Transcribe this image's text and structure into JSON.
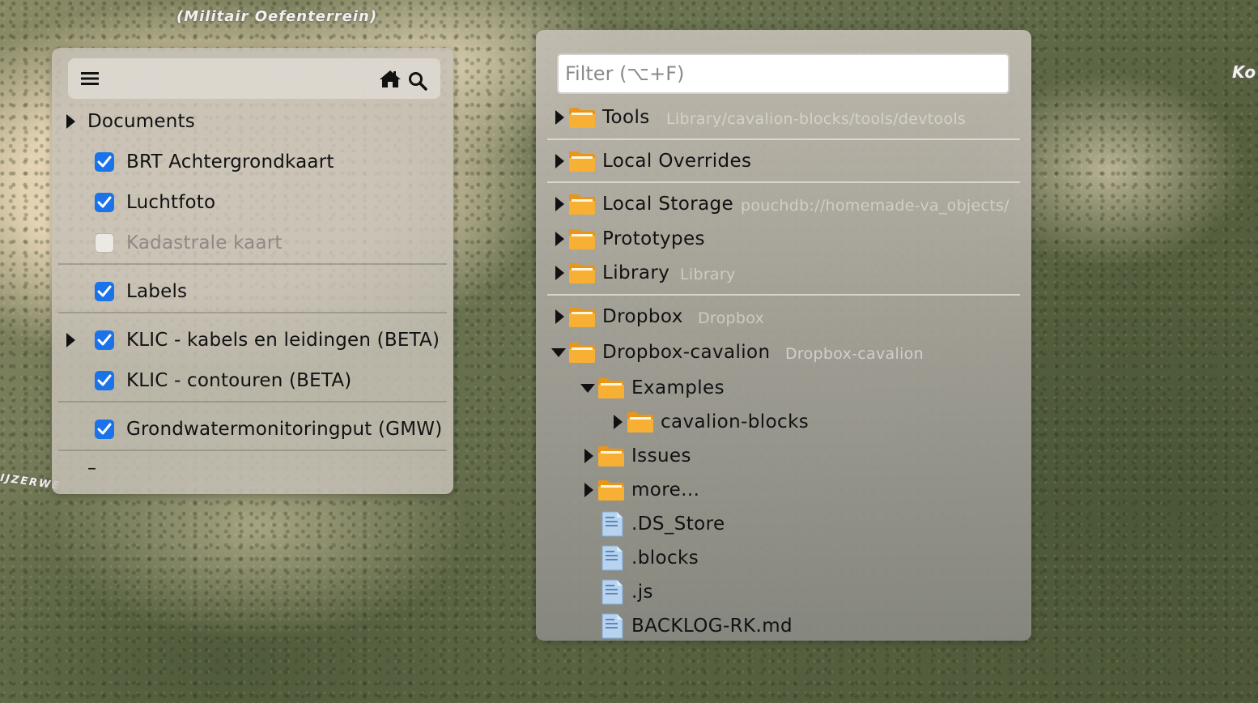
{
  "map": {
    "labels": {
      "top": "(Militair Oefenterrein)",
      "left": "IJZERWE",
      "right": "Ko"
    }
  },
  "layers_panel": {
    "toolbar": {
      "menu_icon": "hamburger-menu-icon",
      "home_icon": "home-icon",
      "search_icon": "search-icon"
    },
    "documents_label": "Documents",
    "layers": [
      {
        "label": "BRT Achtergrondkaart",
        "checked": true
      },
      {
        "label": "Luchtfoto",
        "checked": true
      },
      {
        "label": "Kadastrale kaart",
        "checked": false
      },
      {
        "label": "Labels",
        "checked": true
      },
      {
        "label": "KLIC - kabels en leidingen (BETA)",
        "checked": true,
        "expandable": true
      },
      {
        "label": "KLIC - contouren (BETA)",
        "checked": true
      },
      {
        "label": "Grondwatermonitoringput (GMW)",
        "checked": true
      }
    ],
    "footer_dash": "–"
  },
  "files_panel": {
    "filter": {
      "placeholder": "Filter (⌥+F)",
      "value": ""
    },
    "items": [
      {
        "name": "Tools",
        "path": "Library/cavalion-blocks/tools/devtools",
        "type": "folder",
        "expanded": false
      },
      {
        "name": "Local Overrides",
        "path": "",
        "type": "folder",
        "expanded": false
      },
      {
        "name": "Local Storage",
        "path": "pouchdb://homemade-va_objects/",
        "type": "folder",
        "expanded": false
      },
      {
        "name": "Prototypes",
        "path": "",
        "type": "folder",
        "expanded": false
      },
      {
        "name": "Library",
        "path": "Library",
        "type": "folder",
        "expanded": false
      },
      {
        "name": "Dropbox",
        "path": "Dropbox",
        "type": "folder",
        "expanded": false
      },
      {
        "name": "Dropbox-cavalion",
        "path": "Dropbox-cavalion",
        "type": "folder",
        "expanded": true
      },
      {
        "name": "Examples",
        "path": "",
        "type": "folder",
        "expanded": true
      },
      {
        "name": "cavalion-blocks",
        "path": "",
        "type": "folder",
        "expanded": false
      },
      {
        "name": "Issues",
        "path": "",
        "type": "folder",
        "expanded": false
      },
      {
        "name": "more...",
        "path": "",
        "type": "folder",
        "expanded": false
      },
      {
        "name": ".DS_Store",
        "type": "file"
      },
      {
        "name": ".blocks",
        "type": "file"
      },
      {
        "name": ".js",
        "type": "file"
      },
      {
        "name": "BACKLOG-RK.md",
        "type": "file"
      }
    ]
  },
  "colors": {
    "checkbox_accent": "#1a73e8",
    "folder": "#f6a823",
    "file": "#a9c9ec"
  }
}
